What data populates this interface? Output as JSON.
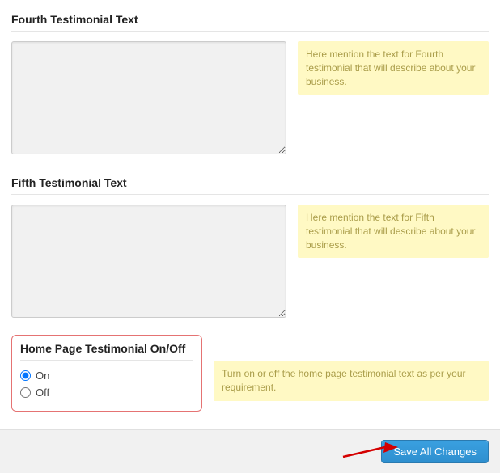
{
  "sections": {
    "fourth": {
      "title": "Fourth Testimonial Text",
      "value": "",
      "hint": "Here mention the text for Fourth testimonial that will describe about your business."
    },
    "fifth": {
      "title": "Fifth Testimonial Text",
      "value": "",
      "hint": "Here mention the text for Fifth testimonial that will describe about your business."
    },
    "toggle": {
      "title": "Home Page Testimonial On/Off",
      "on_label": "On",
      "off_label": "Off",
      "selected": "on",
      "hint": "Turn on or off the home page testimonial text as per your requirement."
    }
  },
  "footer": {
    "save_label": "Save All Changes"
  }
}
